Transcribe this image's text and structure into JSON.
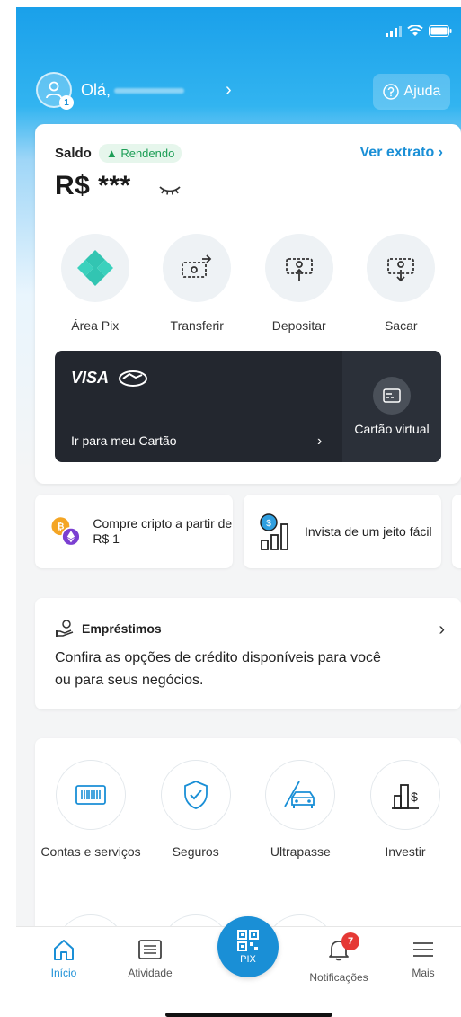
{
  "header": {
    "greeting": "Olá,",
    "avatar_badge": "1",
    "help_label": "Ajuda"
  },
  "balance": {
    "label": "Saldo",
    "badge": "Rendendo",
    "statement_link": "Ver extrato",
    "amount": "R$ ***"
  },
  "actions": [
    {
      "label": "Área Pix",
      "icon": "pix-icon"
    },
    {
      "label": "Transferir",
      "icon": "transfer-icon"
    },
    {
      "label": "Depositar",
      "icon": "deposit-icon"
    },
    {
      "label": "Sacar",
      "icon": "withdraw-icon"
    }
  ],
  "card": {
    "brand": "VISA",
    "go_to_label": "Ir para meu Cartão",
    "virtual_label": "Cartão virtual"
  },
  "promos": [
    {
      "text": "Compre cripto a partir de R$ 1",
      "icon": "crypto-icon"
    },
    {
      "text": "Invista de um jeito fácil",
      "icon": "invest-chart-icon"
    }
  ],
  "loans": {
    "title": "Empréstimos",
    "description": "Confira as opções de crédito disponíveis para você ou para seus negócios."
  },
  "services": [
    {
      "label": "Contas e serviços",
      "icon": "barcode-icon"
    },
    {
      "label": "Seguros",
      "icon": "shield-check-icon"
    },
    {
      "label": "Ultrapasse",
      "icon": "car-icon"
    },
    {
      "label": "Investir",
      "icon": "building-dollar-icon"
    }
  ],
  "bottom_nav": {
    "home": "Início",
    "activity": "Atividade",
    "pix": "PIX",
    "notifications": "Notificações",
    "notifications_count": "7",
    "more": "Mais"
  },
  "colors": {
    "brand_blue": "#1a8fd6",
    "header_top": "#1aa0ea",
    "card_dark": "#23272f",
    "badge_red": "#e53935",
    "positive_green": "#1e9e57"
  }
}
